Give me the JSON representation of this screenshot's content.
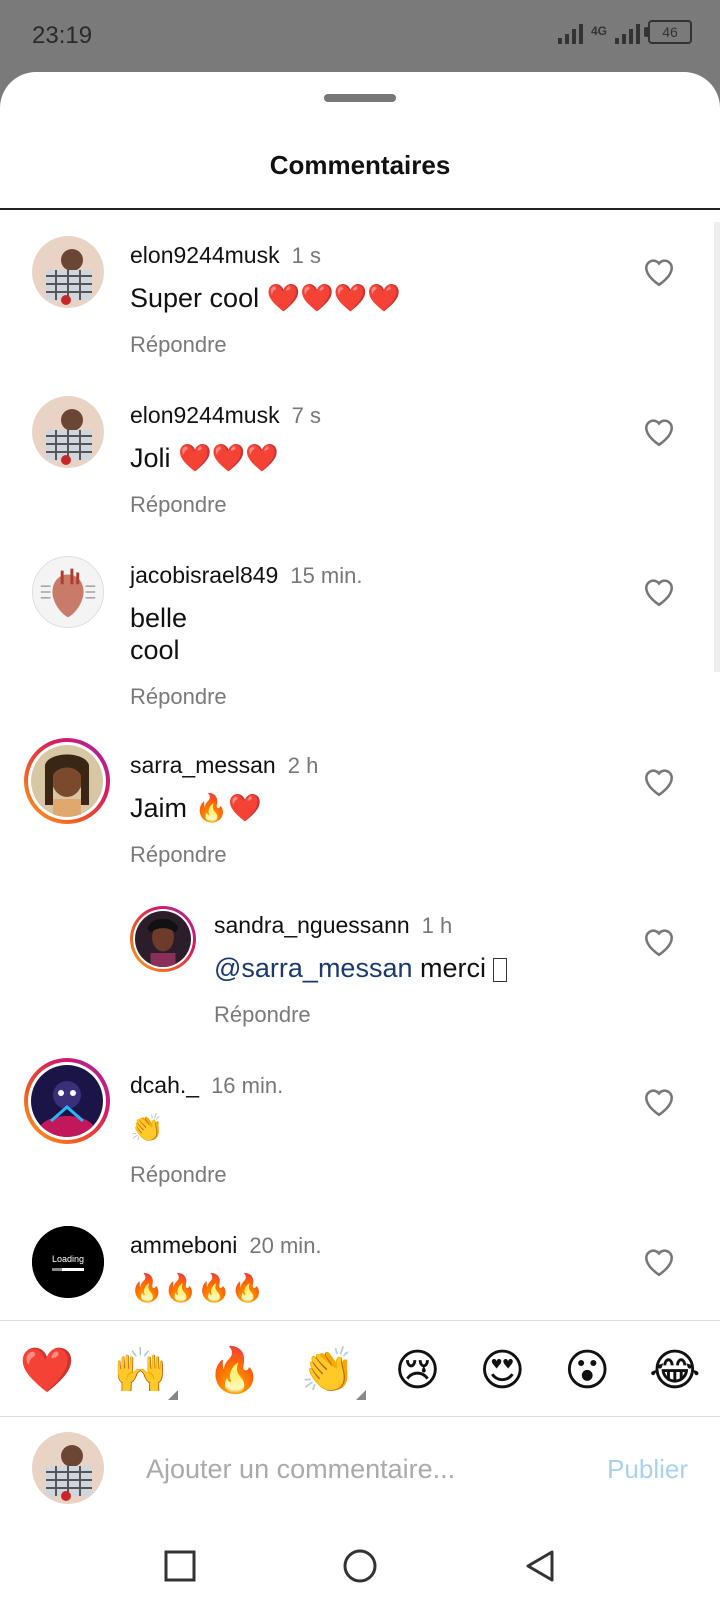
{
  "status": {
    "time": "23:19",
    "network": "4G",
    "battery": "46"
  },
  "sheet": {
    "title": "Commentaires"
  },
  "comments": [
    {
      "username": "elon9244musk",
      "time": "1 s",
      "text": "Super cool ❤️❤️❤️❤️",
      "reply": "Répondre"
    },
    {
      "username": "elon9244musk",
      "time": "7 s",
      "text": "Joli ❤️❤️❤️",
      "reply": "Répondre"
    },
    {
      "username": "jacobisrael849",
      "time": "15 min.",
      "text": "belle\ncool",
      "reply": "Répondre"
    },
    {
      "username": "sarra_messan",
      "time": "2 h",
      "text": "Jaim 🔥❤️",
      "reply": "Répondre"
    },
    {
      "username": "sandra_nguessann",
      "time": "1 h",
      "mention": "@sarra_messan",
      "text": " merci ",
      "reply": "Répondre"
    },
    {
      "username": "dcah._",
      "time": "16 min.",
      "text": "👏",
      "reply": "Répondre"
    },
    {
      "username": "ammeboni",
      "time": "20 min.",
      "text": "🔥🔥🔥🔥",
      "avatar_text": "Loading"
    }
  ],
  "quick_reactions": [
    "❤️",
    "🙌",
    "🔥",
    "👏",
    "😢",
    "😍",
    "😮",
    "😂"
  ],
  "composer": {
    "placeholder": "Ajouter un commentaire...",
    "publish_label": "Publier"
  },
  "colors": {
    "accent_disabled": "#a9d2f1",
    "story_ring": "#d81b60",
    "mention": "#1a3a6e"
  },
  "icons": {
    "like": "heart-outline-icon",
    "nav": [
      "recents-square-icon",
      "home-circle-icon",
      "back-triangle-icon"
    ]
  }
}
